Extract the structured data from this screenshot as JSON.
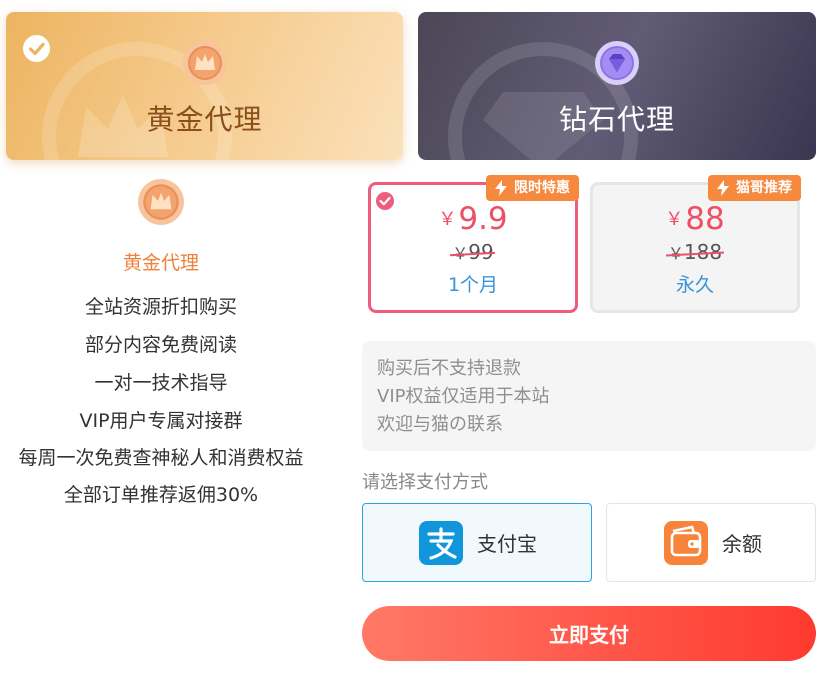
{
  "tiers": [
    {
      "title": "黄金代理",
      "selected": true
    },
    {
      "title": "钻石代理",
      "selected": false
    }
  ],
  "plan_info": {
    "name": "黄金代理",
    "benefits": [
      "全站资源折扣购买",
      "部分内容免费阅读",
      "一对一技术指导",
      "VIP用户专属对接群",
      "每周一次免费查神秘人和消费权益",
      "全部订单推荐返佣30%"
    ]
  },
  "prices": [
    {
      "tag": "限时特惠",
      "currency": "￥",
      "price": "9.9",
      "original": "99",
      "period": "1个月",
      "selected": true
    },
    {
      "tag": "猫哥推荐",
      "currency": "￥",
      "price": "88",
      "original": "188",
      "period": "永久",
      "selected": false
    }
  ],
  "notice": {
    "lines": [
      "购买后不支持退款",
      "VIP权益仅适用于本站",
      "欢迎与猫の联系"
    ]
  },
  "payment": {
    "label": "请选择支付方式",
    "methods": [
      {
        "label": "支付宝",
        "icon": "alipay-icon",
        "selected": true
      },
      {
        "label": "余额",
        "icon": "wallet-icon",
        "selected": false
      }
    ]
  },
  "submit_label": "立即支付",
  "colors": {
    "accent": "#ee5c7e",
    "price": "#ee4f64",
    "period": "#3a94d8",
    "tag": "#f6893e",
    "submit_start": "#ff7966",
    "submit_end": "#ff3a2f",
    "alipay": "#1296db"
  }
}
